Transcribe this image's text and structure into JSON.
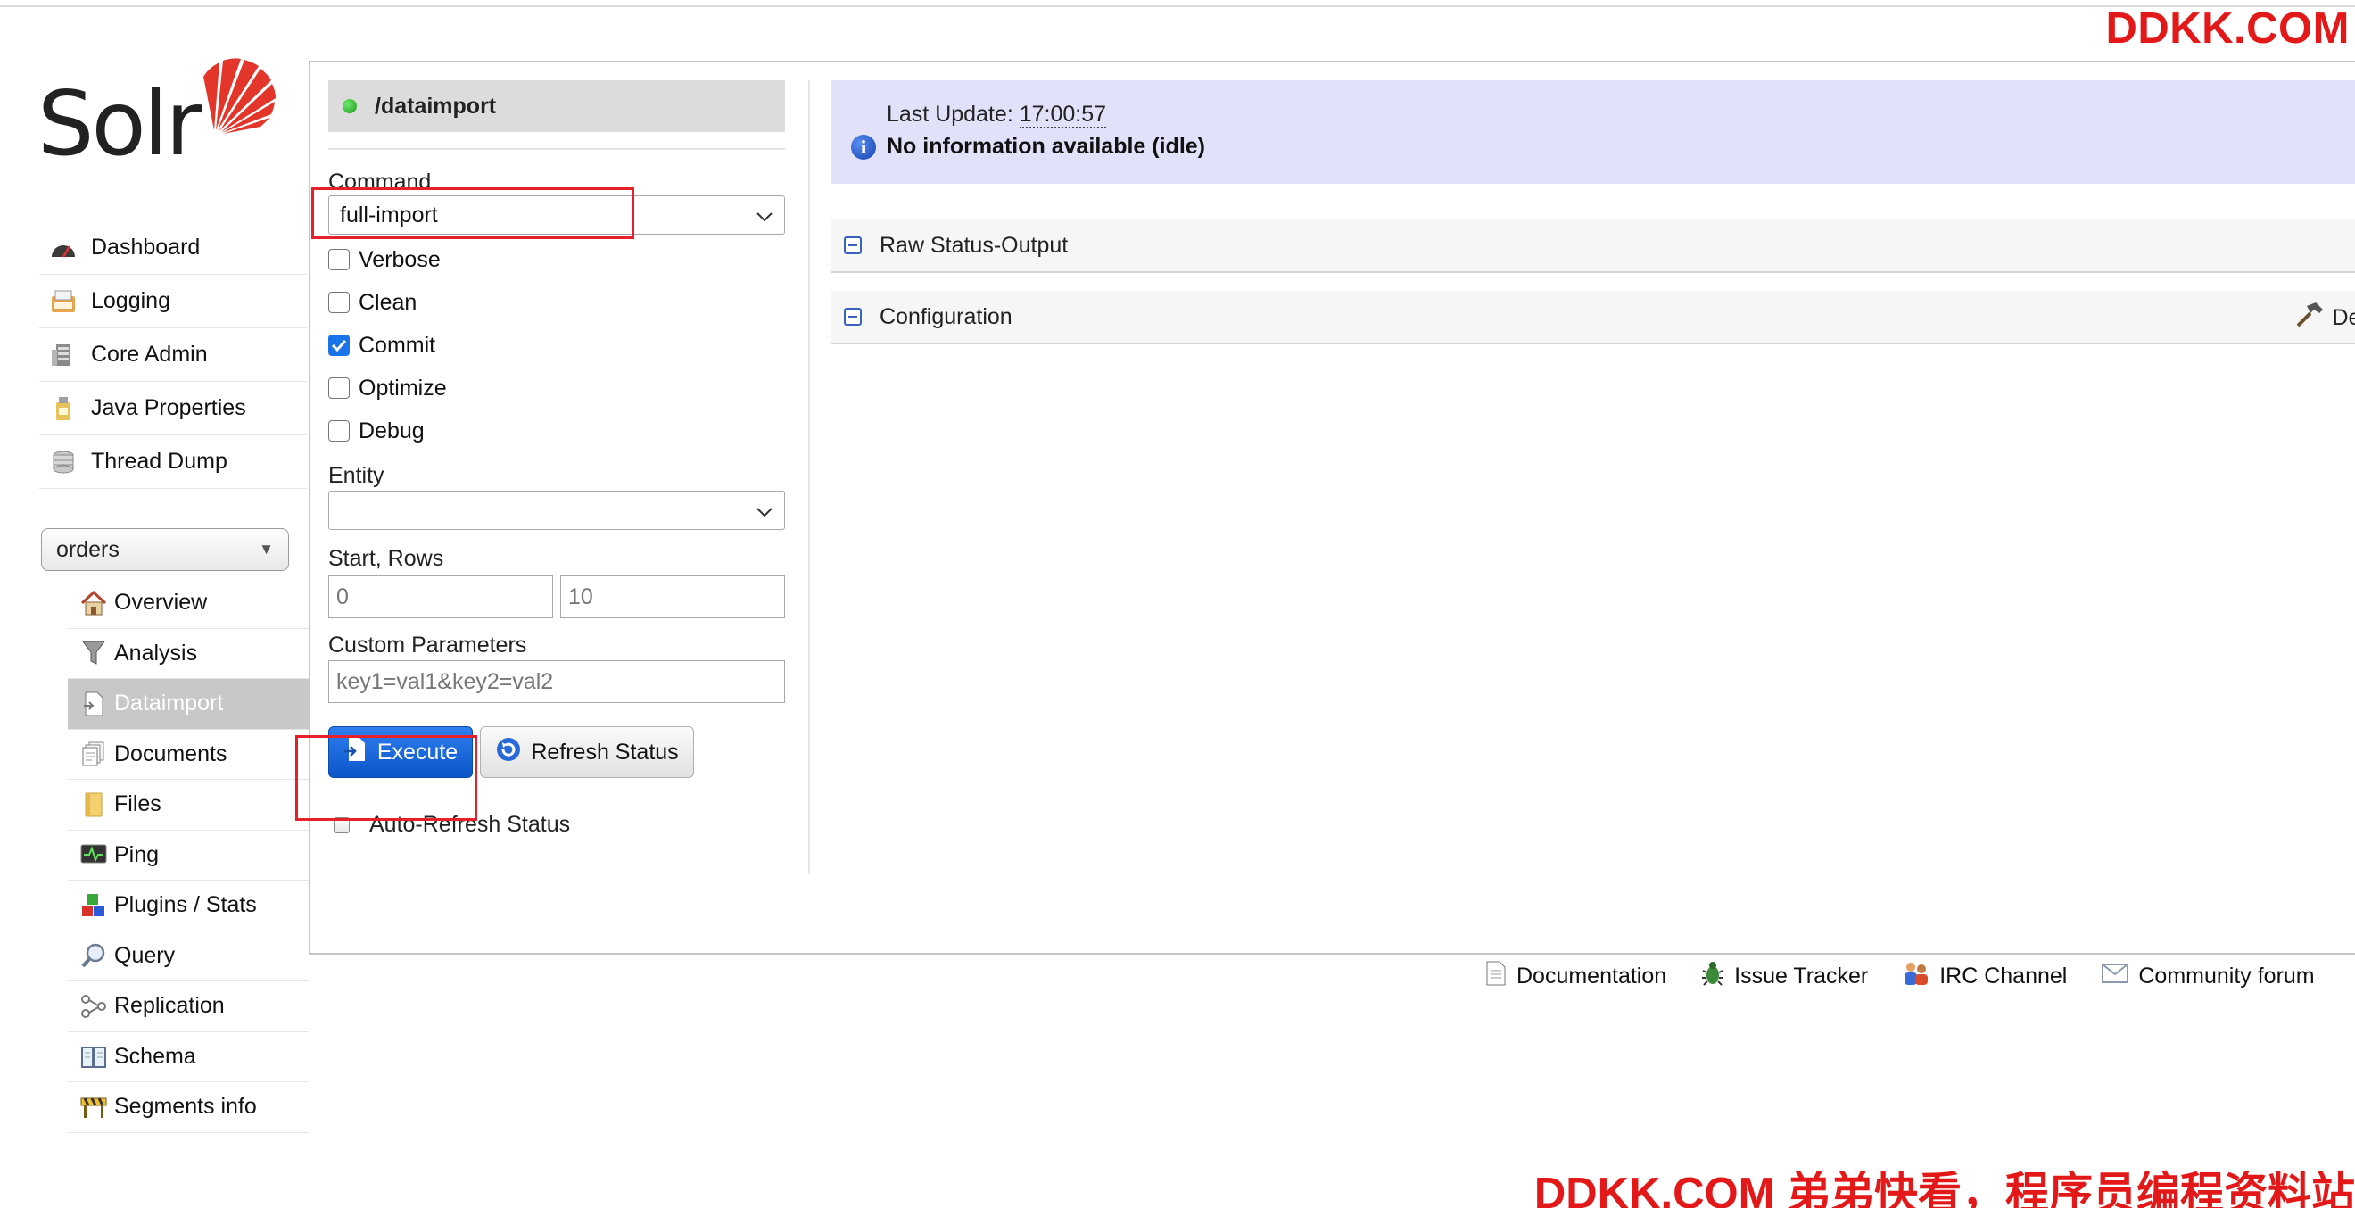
{
  "watermark": {
    "top": "DDKK.COM",
    "bottom": "DDKK.COM 弟弟快看，程序员编程资料站"
  },
  "logo": {
    "text": "Solr"
  },
  "main_nav": [
    {
      "label": "Dashboard",
      "icon": "dashboard-icon"
    },
    {
      "label": "Logging",
      "icon": "logging-icon"
    },
    {
      "label": "Core Admin",
      "icon": "core-admin-icon"
    },
    {
      "label": "Java Properties",
      "icon": "java-properties-icon"
    },
    {
      "label": "Thread Dump",
      "icon": "thread-dump-icon"
    }
  ],
  "core_selector": {
    "value": "orders"
  },
  "core_nav": [
    {
      "label": "Overview",
      "icon": "house-icon",
      "active": false
    },
    {
      "label": "Analysis",
      "icon": "funnel-icon",
      "active": false
    },
    {
      "label": "Dataimport",
      "icon": "dataimport-icon",
      "active": true
    },
    {
      "label": "Documents",
      "icon": "documents-icon",
      "active": false
    },
    {
      "label": "Files",
      "icon": "folder-icon",
      "active": false
    },
    {
      "label": "Ping",
      "icon": "ping-icon",
      "active": false
    },
    {
      "label": "Plugins / Stats",
      "icon": "plugins-icon",
      "active": false
    },
    {
      "label": "Query",
      "icon": "magnifier-icon",
      "active": false
    },
    {
      "label": "Replication",
      "icon": "replication-icon",
      "active": false
    },
    {
      "label": "Schema",
      "icon": "schema-icon",
      "active": false
    },
    {
      "label": "Segments info",
      "icon": "segments-icon",
      "active": false
    }
  ],
  "form": {
    "handler": "/dataimport",
    "command_label": "Command",
    "command_value": "full-import",
    "checkboxes": [
      {
        "label": "Verbose",
        "checked": false
      },
      {
        "label": "Clean",
        "checked": false
      },
      {
        "label": "Commit",
        "checked": true
      },
      {
        "label": "Optimize",
        "checked": false
      },
      {
        "label": "Debug",
        "checked": false
      }
    ],
    "entity_label": "Entity",
    "entity_value": "",
    "start_rows_label": "Start, Rows",
    "start_value": "0",
    "rows_value": "10",
    "custom_params_label": "Custom Parameters",
    "custom_params_value": "key1=val1&key2=val2",
    "execute_label": "Execute",
    "refresh_label": "Refresh Status",
    "auto_refresh_label": "Auto-Refresh Status"
  },
  "status": {
    "last_update_label": "Last Update:",
    "last_update_time": "17:00:57",
    "message": "No information available (idle)"
  },
  "sections": {
    "raw_status": "Raw Status-Output",
    "configuration": "Configuration",
    "debug_link": "Del"
  },
  "footer": [
    {
      "label": "Documentation",
      "icon": "document-icon"
    },
    {
      "label": "Issue Tracker",
      "icon": "bug-icon"
    },
    {
      "label": "IRC Channel",
      "icon": "irc-icon"
    },
    {
      "label": "Community forum",
      "icon": "mail-icon"
    }
  ],
  "colors": {
    "accent_red": "#e31818",
    "execute_blue": "#1a63d8",
    "status_bg": "#e1e1fa"
  }
}
